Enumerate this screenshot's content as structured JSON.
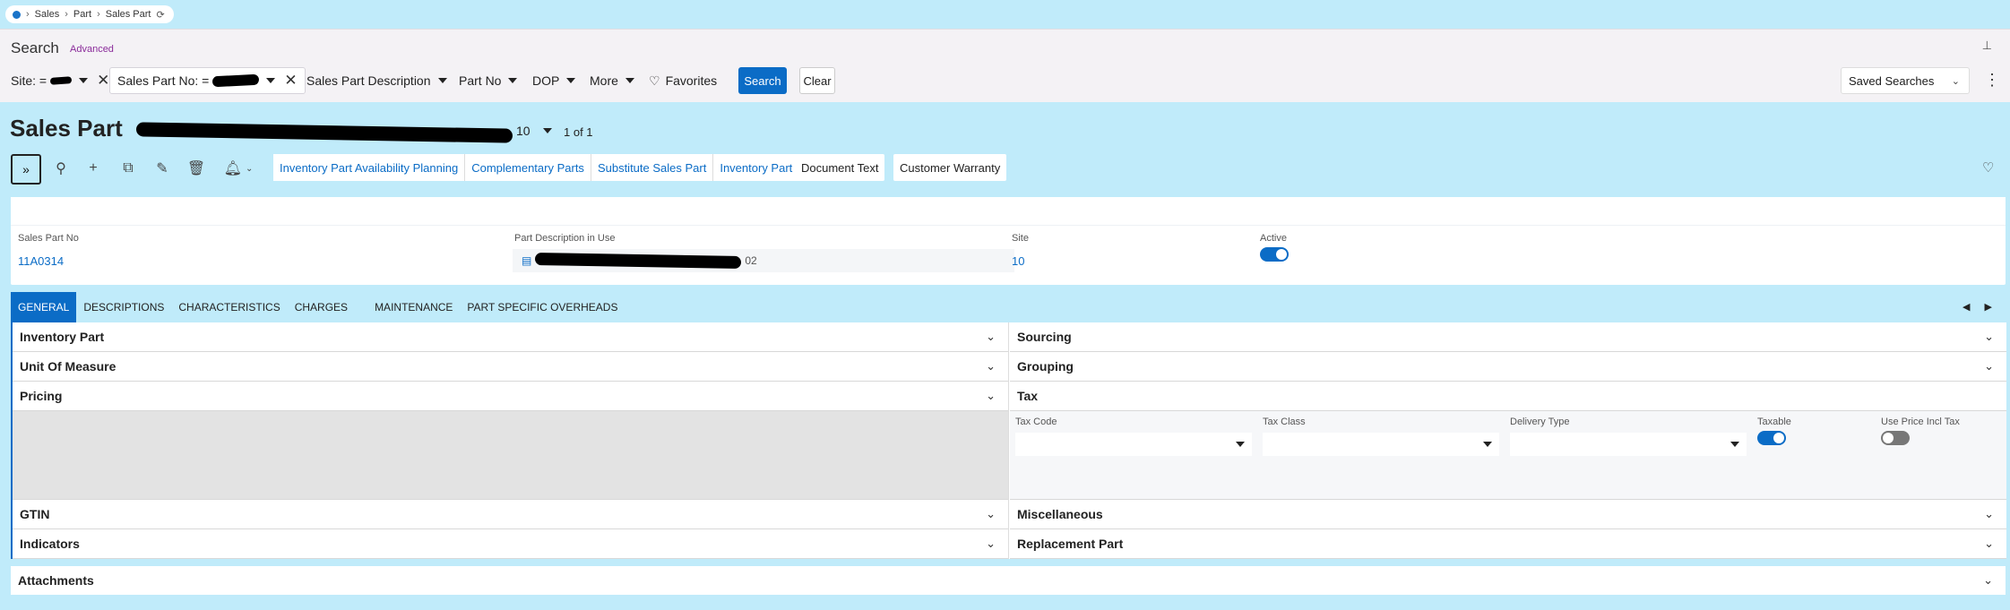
{
  "breadcrumb": [
    "Sales",
    "Part",
    "Sales Part"
  ],
  "search": {
    "title": "Search",
    "advanced": "Advanced",
    "filters": {
      "site_label": "Site: =",
      "sales_part_no_label": "Sales Part No: =",
      "sales_part_description": "Sales Part Description",
      "part_no": "Part No",
      "dop": "DOP",
      "more": "More",
      "favorites": "Favorites"
    },
    "search_button": "Search",
    "clear_button": "Clear",
    "saved_searches": "Saved Searches"
  },
  "page": {
    "title": "Sales Part",
    "title_tail": "10",
    "record_count": "1 of 1"
  },
  "commands": {
    "group": [
      "Inventory Part Availability Planning",
      "Complementary Parts",
      "Substitute Sales Part",
      "Inventory Part"
    ],
    "document_text": "Document Text",
    "customer_warranty": "Customer Warranty"
  },
  "header": {
    "sales_part_no_label": "Sales Part No",
    "sales_part_no_value": "11A0314",
    "part_desc_label": "Part Description in Use",
    "part_desc_tail": "02",
    "site_label": "Site",
    "site_value": "10",
    "active_label": "Active",
    "active": true
  },
  "tabs": [
    "GENERAL",
    "DESCRIPTIONS",
    "CHARACTERISTICS",
    "CHARGES",
    "MAINTENANCE",
    "PART SPECIFIC OVERHEADS"
  ],
  "sections": {
    "left": [
      "Inventory Part",
      "Unit Of Measure",
      "Pricing",
      "GTIN",
      "Indicators"
    ],
    "right": [
      "Sourcing",
      "Grouping",
      "Tax",
      "Miscellaneous",
      "Replacement Part"
    ]
  },
  "tax": {
    "tax_code": "Tax Code",
    "tax_class": "Tax Class",
    "delivery_type": "Delivery Type",
    "taxable": "Taxable",
    "taxable_on": true,
    "use_price_incl_tax": "Use Price Incl Tax",
    "use_price_incl_tax_on": false
  },
  "attachments": "Attachments",
  "colors": {
    "accent": "#0b6cc6",
    "background": "#c0ebfa",
    "advanced": "#8a2b9a"
  }
}
